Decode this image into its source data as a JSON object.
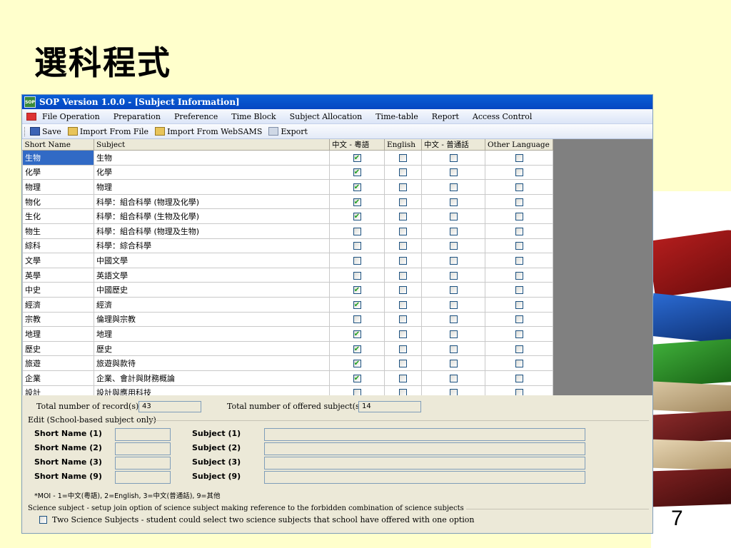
{
  "slide": {
    "title": "選科程式",
    "page_number": "7"
  },
  "window": {
    "title": "SOP Version 1.0.0 - [Subject Information]",
    "icon_text": "SOP"
  },
  "menu": [
    "File Operation",
    "Preparation",
    "Preference",
    "Time Block",
    "Subject Allocation",
    "Time-table",
    "Report",
    "Access Control"
  ],
  "toolbar": {
    "save": "Save",
    "import_file": "Import From File",
    "import_websams": "Import From WebSAMS",
    "export": "Export"
  },
  "grid": {
    "columns": [
      "Short Name",
      "Subject",
      "中文 - 粵語",
      "English",
      "中文 - 普通話",
      "Other Language"
    ],
    "rows": [
      {
        "short": "生物",
        "subject": "生物",
        "c": [
          true,
          false,
          false,
          false
        ],
        "selected": true
      },
      {
        "short": "化學",
        "subject": "化學",
        "c": [
          true,
          false,
          false,
          false
        ]
      },
      {
        "short": "物理",
        "subject": "物理",
        "c": [
          true,
          false,
          false,
          false
        ]
      },
      {
        "short": "物化",
        "subject": "科學：組合科學 (物理及化學)",
        "c": [
          true,
          false,
          false,
          false
        ]
      },
      {
        "short": "生化",
        "subject": "科學：組合科學 (生物及化學)",
        "c": [
          true,
          false,
          false,
          false
        ]
      },
      {
        "short": "物生",
        "subject": "科學：組合科學 (物理及生物)",
        "c": [
          false,
          false,
          false,
          false
        ]
      },
      {
        "short": "綜科",
        "subject": "科學：綜合科學",
        "c": [
          false,
          false,
          false,
          false
        ]
      },
      {
        "short": "文學",
        "subject": "中國文學",
        "c": [
          false,
          false,
          false,
          false
        ]
      },
      {
        "short": "英學",
        "subject": "英語文學",
        "c": [
          false,
          false,
          false,
          false
        ]
      },
      {
        "short": "中史",
        "subject": "中國歷史",
        "c": [
          true,
          false,
          false,
          false
        ]
      },
      {
        "short": "經濟",
        "subject": "經濟",
        "c": [
          true,
          false,
          false,
          false
        ]
      },
      {
        "short": "宗教",
        "subject": "倫理與宗教",
        "c": [
          false,
          false,
          false,
          false
        ]
      },
      {
        "short": "地理",
        "subject": "地理",
        "c": [
          true,
          false,
          false,
          false
        ]
      },
      {
        "short": "歷史",
        "subject": "歷史",
        "c": [
          true,
          false,
          false,
          false
        ]
      },
      {
        "short": "旅遊",
        "subject": "旅遊與款待",
        "c": [
          true,
          false,
          false,
          false
        ]
      },
      {
        "short": "企業",
        "subject": "企業、會計與財務概論",
        "c": [
          true,
          false,
          false,
          false
        ]
      },
      {
        "short": "設計",
        "subject": "設計與應用科技",
        "c": [
          false,
          false,
          false,
          false
        ]
      },
      {
        "short": "",
        "subject": "",
        "c": [
          false,
          false,
          false,
          false
        ]
      }
    ]
  },
  "form": {
    "total_records_label": "Total number of record(s)",
    "total_records_value": "43",
    "total_offered_label": "Total number of offered subject(s)",
    "total_offered_value": "14",
    "edit_section_label": "Edit (School-based subject only)",
    "fields": [
      {
        "short_label": "Short Name (1)",
        "subject_label": "Subject (1)"
      },
      {
        "short_label": "Short Name (2)",
        "subject_label": "Subject (2)"
      },
      {
        "short_label": "Short Name (3)",
        "subject_label": "Subject (3)"
      },
      {
        "short_label": "Short Name (9)",
        "subject_label": "Subject (9)"
      }
    ],
    "moi_note": "*MOI - 1=中文(粵語), 2=English, 3=中文(普通話), 9=其他",
    "science_section_label": "Science subject - setup join option of science subject making reference to the forbidden combination of science subjects",
    "science_option_label": "Two Science Subjects - student could select two science subjects that school have offered with one option"
  },
  "colors": {
    "slide_bg": "#ffffcc",
    "titlebar": "#0a5fd6",
    "selection": "#316ac5",
    "check": "#21a121"
  }
}
